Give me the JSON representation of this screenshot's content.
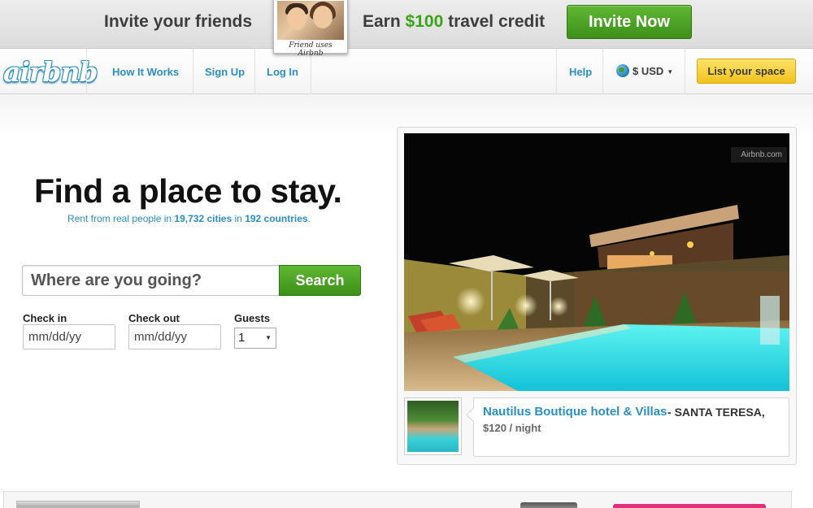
{
  "promo": {
    "left_text": "Invite your friends",
    "polaroid_caption": "Friend uses Airbnb",
    "earn_prefix": "Earn",
    "earn_amount": "$100",
    "earn_suffix": "travel credit",
    "invite_button": "Invite Now"
  },
  "nav": {
    "logo": "airbnb",
    "links": [
      "How It Works",
      "Sign Up",
      "Log In"
    ],
    "help": "Help",
    "currency": "$ USD",
    "list_space": "List your space"
  },
  "hero": {
    "title": "Find a place to stay.",
    "sub_prefix": "Rent from real people in",
    "cities": "19,732 cities",
    "sub_mid": "in",
    "countries": "192 countries",
    "sub_suffix": "."
  },
  "search": {
    "placeholder": "Where are you going?",
    "button": "Search",
    "checkin_label": "Check in",
    "checkin_placeholder": "mm/dd/yy",
    "checkout_label": "Check out",
    "checkout_placeholder": "mm/dd/yy",
    "guests_label": "Guests",
    "guests_value": "1"
  },
  "featured": {
    "watermark": "Airbnb.com",
    "name": "Nautilus Boutique hotel & Villas",
    "separator": " - ",
    "location": "SANTA TERESA,",
    "price": "$120 / night"
  },
  "colors": {
    "accent_blue": "#2a8fc4",
    "green_button": "#3d8f1a",
    "yellow_button": "#f2c21c",
    "earn_green": "#3aa317"
  }
}
